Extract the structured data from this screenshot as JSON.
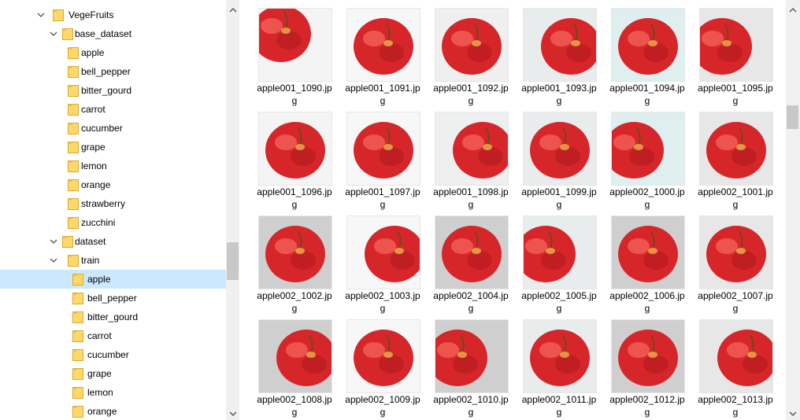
{
  "tree": {
    "items": [
      {
        "label": "VegeFruits",
        "level": 0,
        "expanded": true,
        "selected": false
      },
      {
        "label": "base_dataset",
        "level": 1,
        "expanded": true,
        "selected": false
      },
      {
        "label": "apple",
        "level": 2,
        "expanded": false,
        "selected": false
      },
      {
        "label": "bell_pepper",
        "level": 2,
        "expanded": false,
        "selected": false
      },
      {
        "label": "bitter_gourd",
        "level": 2,
        "expanded": false,
        "selected": false
      },
      {
        "label": "carrot",
        "level": 2,
        "expanded": false,
        "selected": false
      },
      {
        "label": "cucumber",
        "level": 2,
        "expanded": false,
        "selected": false
      },
      {
        "label": "grape",
        "level": 2,
        "expanded": false,
        "selected": false
      },
      {
        "label": "lemon",
        "level": 2,
        "expanded": false,
        "selected": false
      },
      {
        "label": "orange",
        "level": 2,
        "expanded": false,
        "selected": false
      },
      {
        "label": "strawberry",
        "level": 2,
        "expanded": false,
        "selected": false
      },
      {
        "label": "zucchini",
        "level": 2,
        "expanded": false,
        "selected": false
      },
      {
        "label": "dataset",
        "level": 1,
        "expanded": true,
        "selected": false
      },
      {
        "label": "train",
        "level": 2,
        "expanded": true,
        "selected": false
      },
      {
        "label": "apple",
        "level": 3,
        "expanded": false,
        "selected": true
      },
      {
        "label": "bell_pepper",
        "level": 3,
        "expanded": false,
        "selected": false
      },
      {
        "label": "bitter_gourd",
        "level": 3,
        "expanded": false,
        "selected": false
      },
      {
        "label": "carrot",
        "level": 3,
        "expanded": false,
        "selected": false
      },
      {
        "label": "cucumber",
        "level": 3,
        "expanded": false,
        "selected": false
      },
      {
        "label": "grape",
        "level": 3,
        "expanded": false,
        "selected": false
      },
      {
        "label": "lemon",
        "level": 3,
        "expanded": false,
        "selected": false
      },
      {
        "label": "orange",
        "level": 3,
        "expanded": false,
        "selected": false
      }
    ]
  },
  "files": [
    {
      "line1": "apple001_1090.jp",
      "line2": "g"
    },
    {
      "line1": "apple001_1091.jp",
      "line2": "g"
    },
    {
      "line1": "apple001_1092.jp",
      "line2": "g"
    },
    {
      "line1": "apple001_1093.jp",
      "line2": "g"
    },
    {
      "line1": "apple001_1094.jp",
      "line2": "g"
    },
    {
      "line1": "apple001_1095.jp",
      "line2": "g"
    },
    {
      "line1": "apple001_1096.jp",
      "line2": "g"
    },
    {
      "line1": "apple001_1097.jp",
      "line2": "g"
    },
    {
      "line1": "apple001_1098.jp",
      "line2": "g"
    },
    {
      "line1": "apple001_1099.jp",
      "line2": "g"
    },
    {
      "line1": "apple002_1000.jp",
      "line2": "g"
    },
    {
      "line1": "apple002_1001.jp",
      "line2": "g"
    },
    {
      "line1": "apple002_1002.jp",
      "line2": "g"
    },
    {
      "line1": "apple002_1003.jp",
      "line2": "g"
    },
    {
      "line1": "apple002_1004.jp",
      "line2": "g"
    },
    {
      "line1": "apple002_1005.jp",
      "line2": "g"
    },
    {
      "line1": "apple002_1006.jp",
      "line2": "g"
    },
    {
      "line1": "apple002_1007.jp",
      "line2": "g"
    },
    {
      "line1": "apple002_1008.jp",
      "line2": "g"
    },
    {
      "line1": "apple002_1009.jp",
      "line2": "g"
    },
    {
      "line1": "apple002_1010.jp",
      "line2": "g"
    },
    {
      "line1": "apple002_1011.jp",
      "line2": "g"
    },
    {
      "line1": "apple002_1012.jp",
      "line2": "g"
    },
    {
      "line1": "apple002_1013.jp",
      "line2": "g"
    }
  ],
  "colors": {
    "selection": "#cce8ff",
    "folder": "#ffd86b",
    "apple_red": "#d7262a"
  }
}
